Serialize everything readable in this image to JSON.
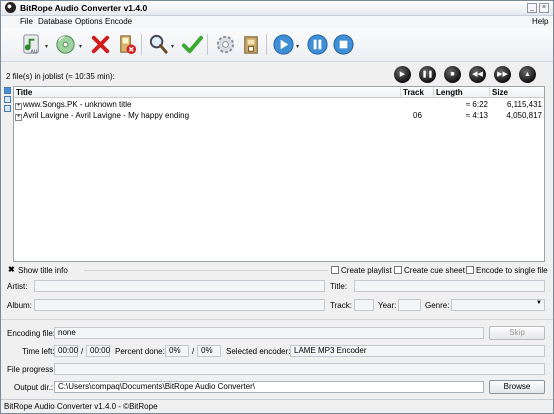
{
  "window": {
    "title": "BitRope Audio Converter v1.4.0"
  },
  "menu": {
    "file": "File",
    "database": "Database",
    "options": "Options",
    "encode": "Encode",
    "help": "Help"
  },
  "toolbar": {
    "icons": [
      "add-audio-icon",
      "add-cd-icon",
      "remove-icon",
      "clear-list-icon",
      "search-icon",
      "check-icon",
      "settings-icon",
      "tools-icon",
      "play-icon",
      "pause-icon",
      "stop-icon"
    ]
  },
  "joblist": {
    "summary": "2 file(s) in joblist (≈ 10:35 min):"
  },
  "list": {
    "columns": {
      "title": "Title",
      "track": "Track",
      "length": "Length",
      "size": "Size"
    },
    "rows": [
      {
        "expander": "+",
        "title": "www.Songs.PK - unknown title",
        "track": "",
        "length": "≈ 6:22",
        "size": "6,115,431"
      },
      {
        "expander": "+",
        "title": "Avril Lavigne - Avril Lavigne - My happy ending",
        "track": "06",
        "length": "≈ 4:13",
        "size": "4,050,817"
      }
    ]
  },
  "options": {
    "show_title_info": "Show title info",
    "create_playlist": "Create playlist",
    "create_cue_sheet": "Create cue sheet",
    "encode_to_single_file": "Encode to single file"
  },
  "tags": {
    "artist": "Artist:",
    "title": "Title:",
    "album": "Album:",
    "track": "Track:",
    "year": "Year:",
    "genre": "Genre:"
  },
  "encoding": {
    "file_label": "Encoding file:",
    "file_value": "none",
    "skip": "Skip",
    "time_left_label": "Time left:",
    "time_elapsed": "00:00",
    "time_slash": "/",
    "time_total": "00:00",
    "percent_label": "Percent done:",
    "percent_file": "0%",
    "percent_slash": "/",
    "percent_total": "0%",
    "encoder_label": "Selected encoder:",
    "encoder_value": "LAME MP3 Encoder",
    "progress_label": "File progress:",
    "output_label": "Output dir.:",
    "output_value": "C:\\Users\\compaq\\Documents\\BitRope Audio Converter\\",
    "browse": "Browse"
  },
  "status": {
    "text": "BitRope Audio Converter v1.4.0 - ©BitRope"
  }
}
